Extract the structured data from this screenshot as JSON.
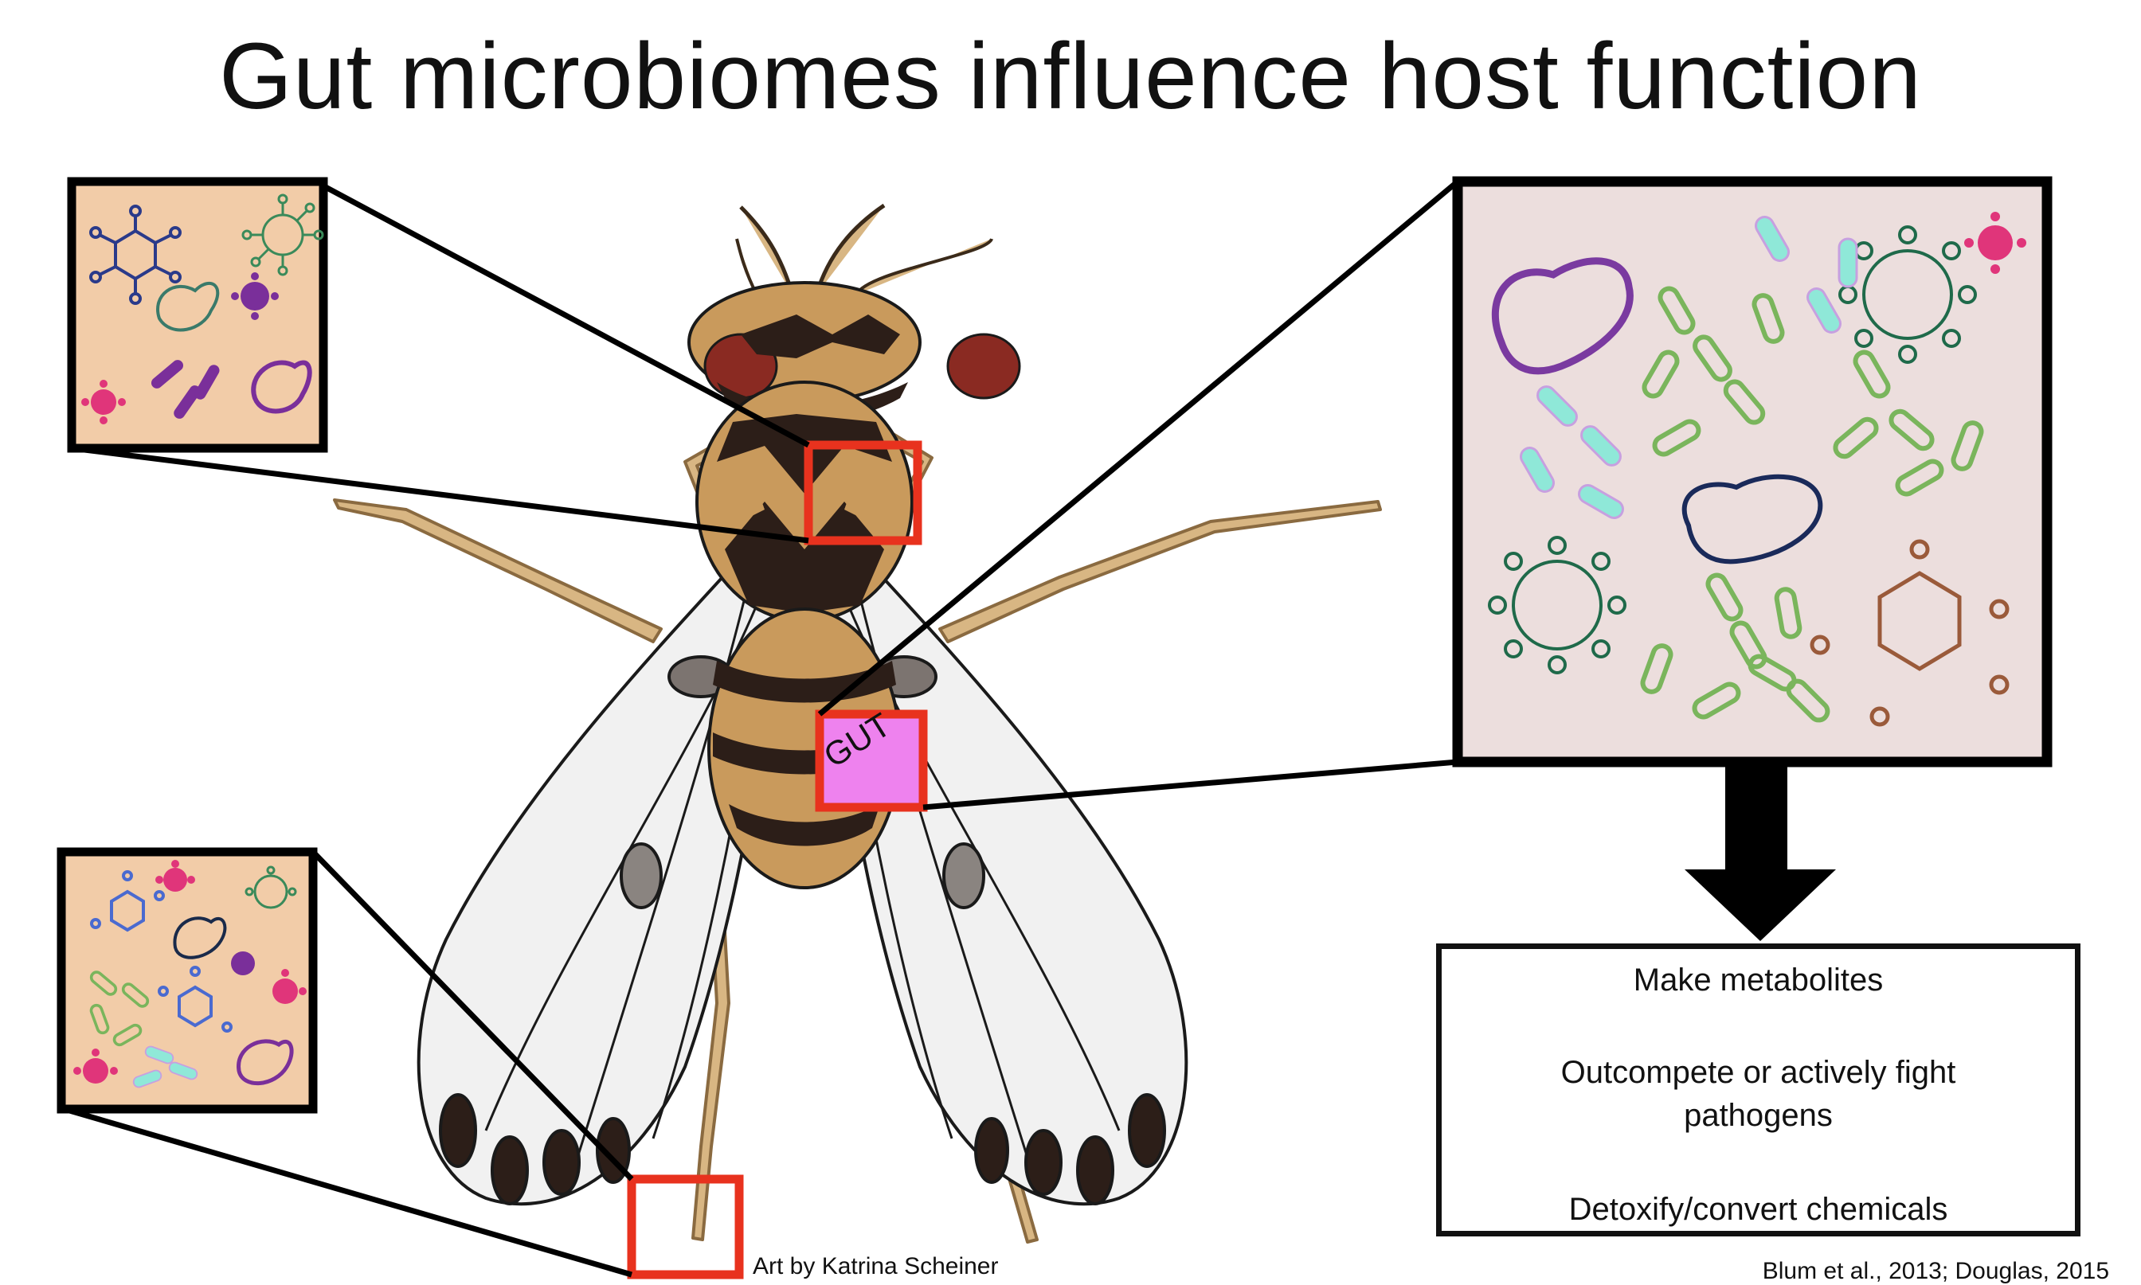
{
  "title": "Gut microbiomes influence host function",
  "gut_label": "GUT",
  "credit": "Art by Katrina Scheiner",
  "citation": "Blum et al., 2013; Douglas, 2015",
  "outcomes": [
    "Make metabolites",
    "Outcompete or actively fight",
    "pathogens",
    "Detoxify/convert chemicals"
  ],
  "colors": {
    "highlight": "#e8321e",
    "gut_fill": "#ee82ee",
    "panel_small_bg": "#f2cca8",
    "panel_large_bg": "#ecdedd",
    "fly_body": "#c99a5c",
    "fly_dark": "#2c1e18",
    "wing": "#f1f1f1"
  }
}
